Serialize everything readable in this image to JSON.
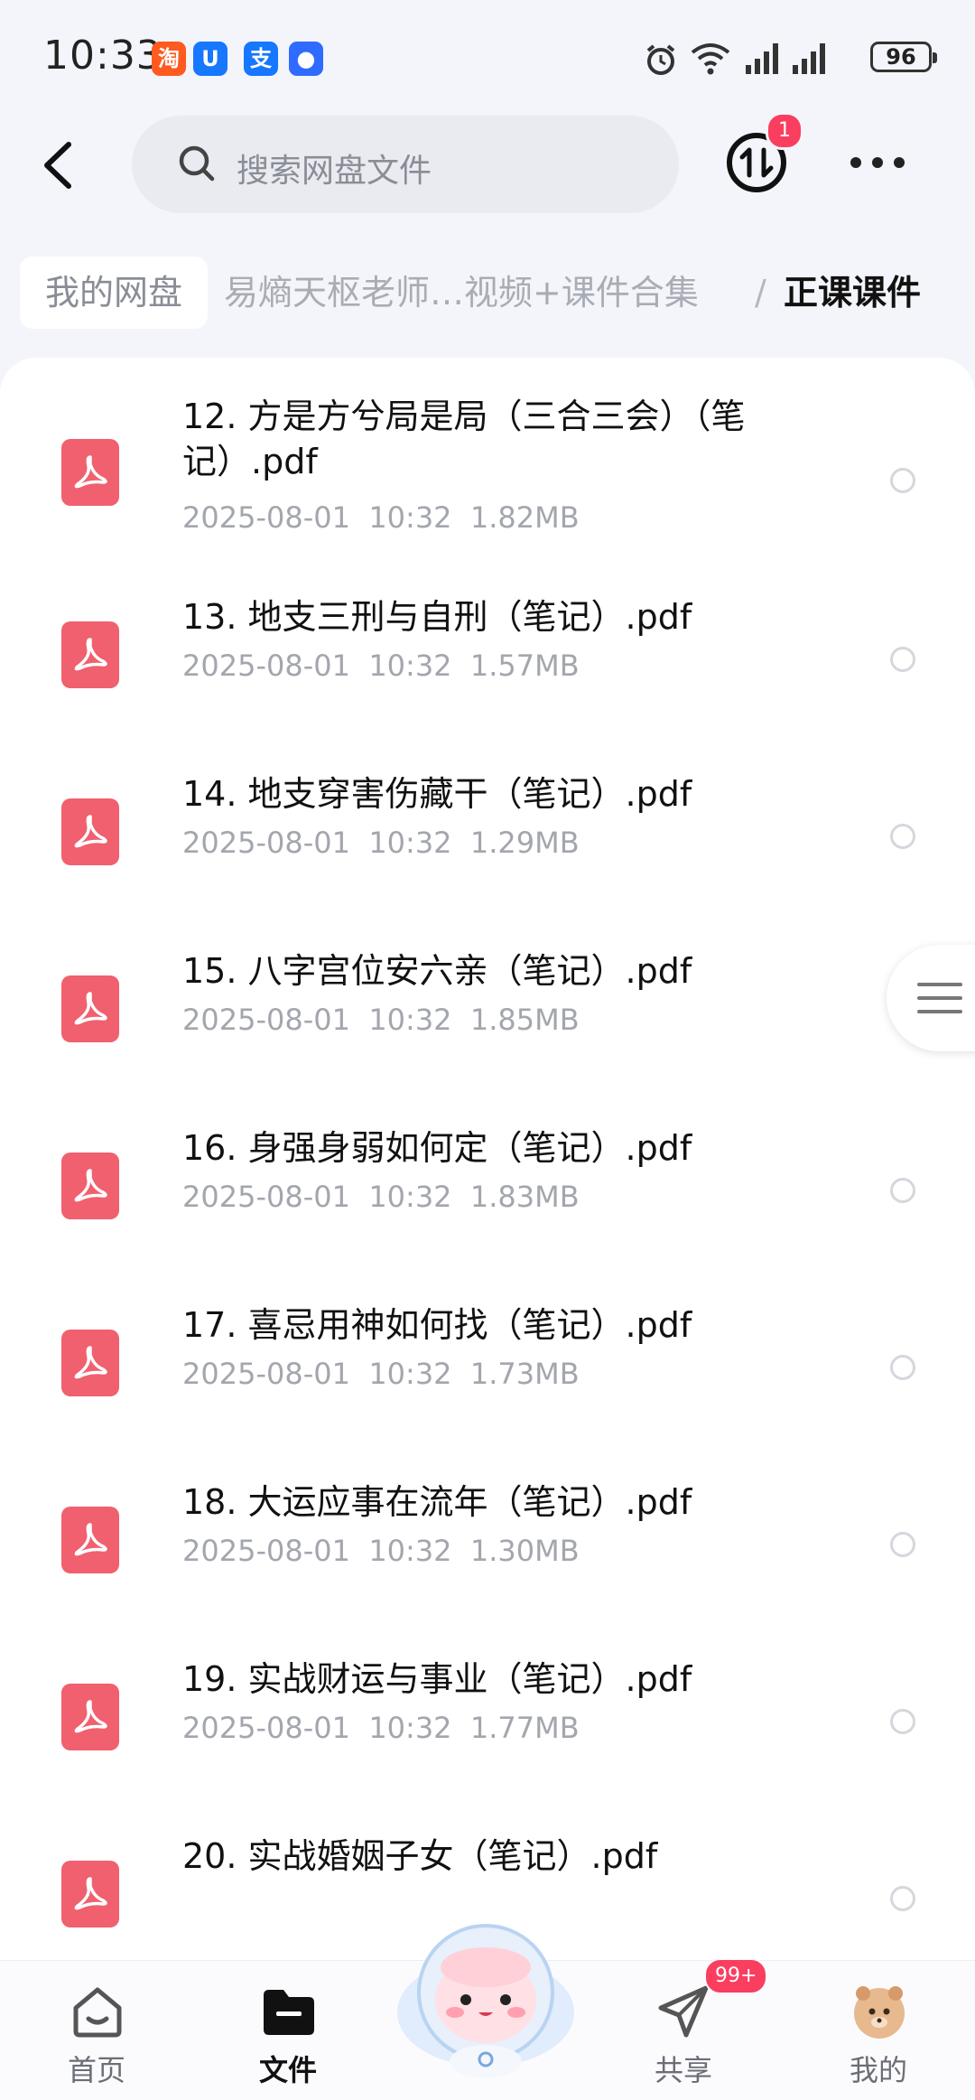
{
  "status_bar": {
    "time": "10:33",
    "battery": "96",
    "notification_icons": [
      {
        "name": "taobao-icon",
        "glyph": "淘",
        "color": "#ff5a1f"
      },
      {
        "name": "qq-icon",
        "glyph": "U",
        "color": "#1677ff"
      },
      {
        "name": "alipay-icon",
        "glyph": "支",
        "color": "#1677ff"
      },
      {
        "name": "app-icon",
        "glyph": "●",
        "color": "#2f6bff"
      }
    ]
  },
  "header": {
    "search_placeholder": "搜索网盘文件",
    "transfer_badge": "1"
  },
  "breadcrumb": {
    "root": "我的网盘",
    "middle": "易熵天枢老师…视频+课件合集",
    "separator": "/",
    "current": "正课课件"
  },
  "files": [
    {
      "name": "",
      "date": "2025-08-01",
      "time": "10:32",
      "size": "1.29MB"
    },
    {
      "name": "12. 方是方兮局是局（三合三会）（笔记）.pdf",
      "date": "2025-08-01",
      "time": "10:32",
      "size": "1.82MB"
    },
    {
      "name": "13. 地支三刑与自刑（笔记）.pdf",
      "date": "2025-08-01",
      "time": "10:32",
      "size": "1.57MB"
    },
    {
      "name": "14. 地支穿害伤藏干（笔记）.pdf",
      "date": "2025-08-01",
      "time": "10:32",
      "size": "1.29MB"
    },
    {
      "name": "15. 八字宫位安六亲（笔记）.pdf",
      "date": "2025-08-01",
      "time": "10:32",
      "size": "1.85MB"
    },
    {
      "name": "16. 身强身弱如何定（笔记）.pdf",
      "date": "2025-08-01",
      "time": "10:32",
      "size": "1.83MB"
    },
    {
      "name": "17. 喜忌用神如何找（笔记）.pdf",
      "date": "2025-08-01",
      "time": "10:32",
      "size": "1.73MB"
    },
    {
      "name": "18. 大运应事在流年（笔记）.pdf",
      "date": "2025-08-01",
      "time": "10:32",
      "size": "1.30MB"
    },
    {
      "name": "19. 实战财运与事业（笔记）.pdf",
      "date": "2025-08-01",
      "time": "10:32",
      "size": "1.77MB"
    },
    {
      "name": "20. 实战婚姻子女（笔记）.pdf",
      "date": "",
      "time": "",
      "size": ""
    }
  ],
  "bottom_nav": {
    "home": "首页",
    "files": "文件",
    "share": "共享",
    "share_badge": "99+",
    "me": "我的"
  },
  "colors": {
    "accent": "#fa3e5f",
    "pdf_icon": "#f0606e"
  }
}
